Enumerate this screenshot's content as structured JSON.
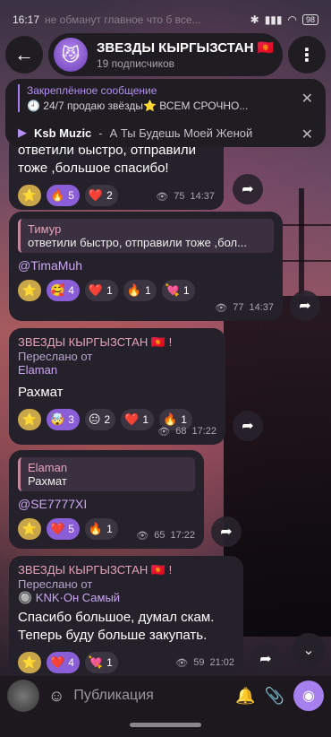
{
  "status_bar": {
    "time": "16:17",
    "ghost_text": "не обманут главное что б все...",
    "battery": "98"
  },
  "header": {
    "title": "ЗВЕЗДЫ КЫРГЫЗСТАН 🇰🇬",
    "subtitle": "19 подписчиков"
  },
  "pinned": {
    "label": "Закреплённое сообщение",
    "text": "🕘 24/7 продаю звёзды⭐  ВСЕМ СРОЧНО...",
    "music_artist": "Ksb Muzic",
    "music_sep": "-",
    "music_title": "А Ты Будешь Моей Женой"
  },
  "messages": [
    {
      "text_line1": "ответили быстро, отправили",
      "text_line2": "тоже ,большое спасибо!",
      "reactions": [
        {
          "emoji": "🔥",
          "count": "5"
        },
        {
          "emoji": "❤️",
          "count": "2"
        }
      ],
      "views": "75",
      "time": "14:37"
    },
    {
      "reply_name": "Тимур",
      "reply_text": "ответили быстро, отправили тоже ,бол...",
      "mention": "@TimaMuh",
      "reactions": [
        {
          "emoji": "🥰",
          "count": "4"
        },
        {
          "emoji": "❤️",
          "count": "1"
        },
        {
          "emoji": "🔥",
          "count": "1"
        },
        {
          "emoji": "💘",
          "count": "1"
        }
      ],
      "views": "77",
      "time": "14:37"
    },
    {
      "channel": "ЗВЕЗДЫ КЫРГЫЗСТАН 🇰🇬 !",
      "forwarded_label": "Переслано от",
      "forwarded_name": "Elaman",
      "text": "Рахмат",
      "reactions": [
        {
          "emoji": "🤯",
          "count": "3"
        },
        {
          "emoji": "😐",
          "count": "2"
        },
        {
          "emoji": "❤️",
          "count": "1"
        },
        {
          "emoji": "🔥",
          "count": "1"
        }
      ],
      "views": "68",
      "time": "17:22"
    },
    {
      "reply_name": "Elaman",
      "reply_text": "Рахмат",
      "mention": "@SE7777XI",
      "reactions": [
        {
          "emoji": "❤️",
          "count": "5"
        },
        {
          "emoji": "🔥",
          "count": "1"
        }
      ],
      "views": "65",
      "time": "17:22"
    },
    {
      "channel": "ЗВЕЗДЫ КЫРГЫЗСТАН 🇰🇬 !",
      "forwarded_label": "Переслано от",
      "forwarded_name": "🔘 KNK·Он Самый",
      "text_line1": "Спасибо большое, думал скам.",
      "text_line2": "Теперь буду больше закупать.",
      "reactions": [
        {
          "emoji": "❤️",
          "count": "4"
        },
        {
          "emoji": "💘",
          "count": "1"
        }
      ],
      "views": "59",
      "time": "21:02"
    }
  ],
  "composer": {
    "placeholder": "Публикация"
  },
  "icons": {
    "back": "arrow-left-icon",
    "menu": "more-vertical-icon",
    "share": "share-arrow-icon",
    "star": "star-icon",
    "views": "eye-icon"
  },
  "colors": {
    "accent": "#a780f0",
    "bubble": "#25212a",
    "reply_name": "#e7a1ba"
  }
}
